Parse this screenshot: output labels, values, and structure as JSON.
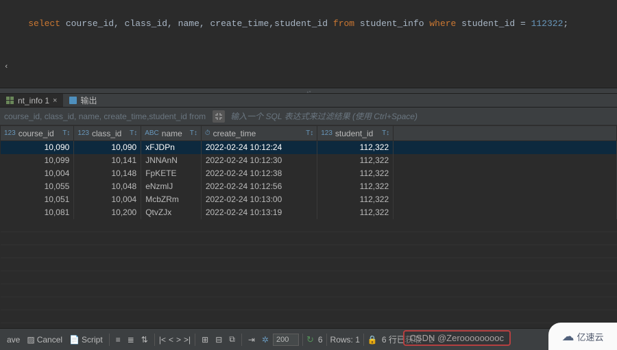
{
  "editor": {
    "sql": {
      "kw_select": "select",
      "cols": " course_id, class_id, name, create_time,student_id ",
      "kw_from": "from",
      "tbl": " student_info ",
      "kw_where": "where",
      "cond_col": " student_id = ",
      "cond_val": "112322",
      "semi": ";"
    }
  },
  "tabs": {
    "result_label": "nt_info 1",
    "result_close": "×",
    "output_label": "输出"
  },
  "filter": {
    "sql_preview": "course_id, class_id, name, create_time,student_id from",
    "placeholder": "输入一个 SQL 表达式来过滤结果 (使用 Ctrl+Space)"
  },
  "columns": [
    {
      "type": "123",
      "name": "course_id"
    },
    {
      "type": "123",
      "name": "class_id"
    },
    {
      "type": "ABC",
      "name": "name"
    },
    {
      "type": "⏱",
      "name": "create_time"
    },
    {
      "type": "123",
      "name": "student_id"
    }
  ],
  "rows": [
    {
      "course_id": "10,090",
      "class_id": "10,090",
      "name": "xFJDPn",
      "create_time": "2022-02-24 10:12:24",
      "student_id": "112,322"
    },
    {
      "course_id": "10,099",
      "class_id": "10,141",
      "name": "JNNAnN",
      "create_time": "2022-02-24 10:12:30",
      "student_id": "112,322"
    },
    {
      "course_id": "10,004",
      "class_id": "10,148",
      "name": "FpKETE",
      "create_time": "2022-02-24 10:12:38",
      "student_id": "112,322"
    },
    {
      "course_id": "10,055",
      "class_id": "10,048",
      "name": "eNzmlJ",
      "create_time": "2022-02-24 10:12:56",
      "student_id": "112,322"
    },
    {
      "course_id": "10,051",
      "class_id": "10,004",
      "name": "McbZRm",
      "create_time": "2022-02-24 10:13:00",
      "student_id": "112,322"
    },
    {
      "course_id": "10,081",
      "class_id": "10,200",
      "name": "QtvZJx",
      "create_time": "2022-02-24 10:13:19",
      "student_id": "112,322"
    }
  ],
  "statusbar": {
    "save": "ave",
    "cancel": "Cancel",
    "script": "Script",
    "page_size": "200",
    "refresh_count": "6",
    "rows_label": "Rows: 1",
    "fetch_label": "6 行已获取 - 2",
    "watermark": "CSDN @Zerooooooooc"
  },
  "brand": {
    "text": "亿速云"
  }
}
